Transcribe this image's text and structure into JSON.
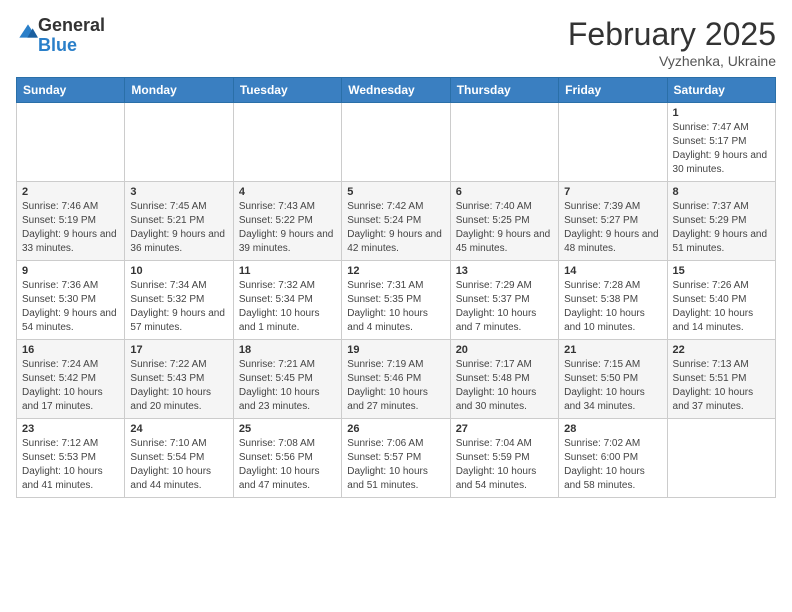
{
  "logo": {
    "general": "General",
    "blue": "Blue"
  },
  "header": {
    "month": "February 2025",
    "location": "Vyzhenka, Ukraine"
  },
  "weekdays": [
    "Sunday",
    "Monday",
    "Tuesday",
    "Wednesday",
    "Thursday",
    "Friday",
    "Saturday"
  ],
  "weeks": [
    [
      {
        "day": "",
        "info": ""
      },
      {
        "day": "",
        "info": ""
      },
      {
        "day": "",
        "info": ""
      },
      {
        "day": "",
        "info": ""
      },
      {
        "day": "",
        "info": ""
      },
      {
        "day": "",
        "info": ""
      },
      {
        "day": "1",
        "info": "Sunrise: 7:47 AM\nSunset: 5:17 PM\nDaylight: 9 hours and 30 minutes."
      }
    ],
    [
      {
        "day": "2",
        "info": "Sunrise: 7:46 AM\nSunset: 5:19 PM\nDaylight: 9 hours and 33 minutes."
      },
      {
        "day": "3",
        "info": "Sunrise: 7:45 AM\nSunset: 5:21 PM\nDaylight: 9 hours and 36 minutes."
      },
      {
        "day": "4",
        "info": "Sunrise: 7:43 AM\nSunset: 5:22 PM\nDaylight: 9 hours and 39 minutes."
      },
      {
        "day": "5",
        "info": "Sunrise: 7:42 AM\nSunset: 5:24 PM\nDaylight: 9 hours and 42 minutes."
      },
      {
        "day": "6",
        "info": "Sunrise: 7:40 AM\nSunset: 5:25 PM\nDaylight: 9 hours and 45 minutes."
      },
      {
        "day": "7",
        "info": "Sunrise: 7:39 AM\nSunset: 5:27 PM\nDaylight: 9 hours and 48 minutes."
      },
      {
        "day": "8",
        "info": "Sunrise: 7:37 AM\nSunset: 5:29 PM\nDaylight: 9 hours and 51 minutes."
      }
    ],
    [
      {
        "day": "9",
        "info": "Sunrise: 7:36 AM\nSunset: 5:30 PM\nDaylight: 9 hours and 54 minutes."
      },
      {
        "day": "10",
        "info": "Sunrise: 7:34 AM\nSunset: 5:32 PM\nDaylight: 9 hours and 57 minutes."
      },
      {
        "day": "11",
        "info": "Sunrise: 7:32 AM\nSunset: 5:34 PM\nDaylight: 10 hours and 1 minute."
      },
      {
        "day": "12",
        "info": "Sunrise: 7:31 AM\nSunset: 5:35 PM\nDaylight: 10 hours and 4 minutes."
      },
      {
        "day": "13",
        "info": "Sunrise: 7:29 AM\nSunset: 5:37 PM\nDaylight: 10 hours and 7 minutes."
      },
      {
        "day": "14",
        "info": "Sunrise: 7:28 AM\nSunset: 5:38 PM\nDaylight: 10 hours and 10 minutes."
      },
      {
        "day": "15",
        "info": "Sunrise: 7:26 AM\nSunset: 5:40 PM\nDaylight: 10 hours and 14 minutes."
      }
    ],
    [
      {
        "day": "16",
        "info": "Sunrise: 7:24 AM\nSunset: 5:42 PM\nDaylight: 10 hours and 17 minutes."
      },
      {
        "day": "17",
        "info": "Sunrise: 7:22 AM\nSunset: 5:43 PM\nDaylight: 10 hours and 20 minutes."
      },
      {
        "day": "18",
        "info": "Sunrise: 7:21 AM\nSunset: 5:45 PM\nDaylight: 10 hours and 23 minutes."
      },
      {
        "day": "19",
        "info": "Sunrise: 7:19 AM\nSunset: 5:46 PM\nDaylight: 10 hours and 27 minutes."
      },
      {
        "day": "20",
        "info": "Sunrise: 7:17 AM\nSunset: 5:48 PM\nDaylight: 10 hours and 30 minutes."
      },
      {
        "day": "21",
        "info": "Sunrise: 7:15 AM\nSunset: 5:50 PM\nDaylight: 10 hours and 34 minutes."
      },
      {
        "day": "22",
        "info": "Sunrise: 7:13 AM\nSunset: 5:51 PM\nDaylight: 10 hours and 37 minutes."
      }
    ],
    [
      {
        "day": "23",
        "info": "Sunrise: 7:12 AM\nSunset: 5:53 PM\nDaylight: 10 hours and 41 minutes."
      },
      {
        "day": "24",
        "info": "Sunrise: 7:10 AM\nSunset: 5:54 PM\nDaylight: 10 hours and 44 minutes."
      },
      {
        "day": "25",
        "info": "Sunrise: 7:08 AM\nSunset: 5:56 PM\nDaylight: 10 hours and 47 minutes."
      },
      {
        "day": "26",
        "info": "Sunrise: 7:06 AM\nSunset: 5:57 PM\nDaylight: 10 hours and 51 minutes."
      },
      {
        "day": "27",
        "info": "Sunrise: 7:04 AM\nSunset: 5:59 PM\nDaylight: 10 hours and 54 minutes."
      },
      {
        "day": "28",
        "info": "Sunrise: 7:02 AM\nSunset: 6:00 PM\nDaylight: 10 hours and 58 minutes."
      },
      {
        "day": "",
        "info": ""
      }
    ]
  ]
}
